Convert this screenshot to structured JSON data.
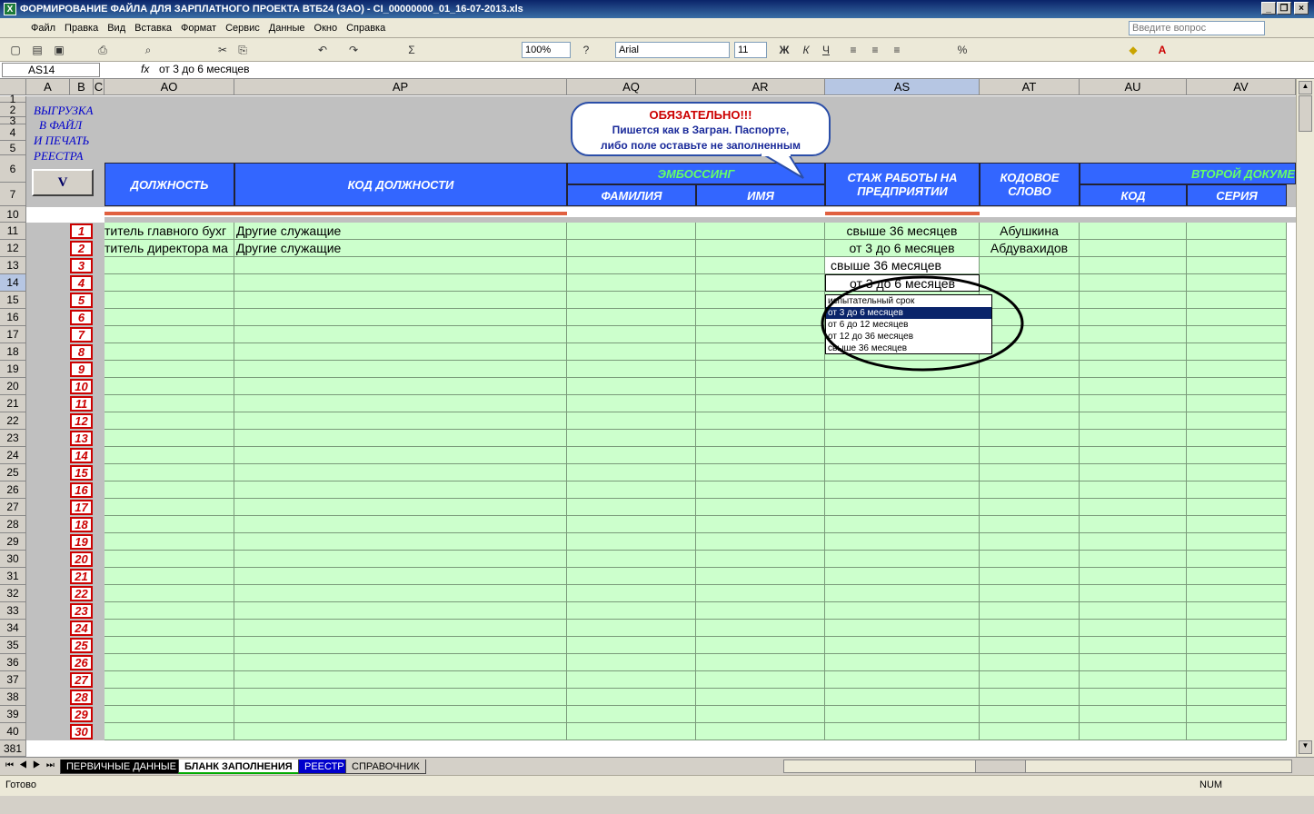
{
  "window": {
    "title": "ФОРМИРОВАНИЕ ФАЙЛА ДЛЯ ЗАРПЛАТНОГО ПРОЕКТА ВТБ24 (ЗАО) - CI_00000000_01_16-07-2013.xls"
  },
  "menu": {
    "items": [
      "Файл",
      "Правка",
      "Вид",
      "Вставка",
      "Формат",
      "Сервис",
      "Данные",
      "Окно",
      "Справка"
    ],
    "ask_placeholder": "Введите вопрос"
  },
  "toolbar": {
    "zoom": "100%",
    "font": "Arial",
    "size": "11"
  },
  "formula": {
    "cell_ref": "AS14",
    "fx": "fx",
    "value": "от 3 до 6 месяцев"
  },
  "columns": [
    "A",
    "B",
    "C",
    "AO",
    "AP",
    "AQ",
    "AR",
    "AS",
    "AT",
    "AU",
    "AV"
  ],
  "row_numbers": [
    "1",
    "2",
    "3",
    "4",
    "5",
    "6",
    "7",
    "10",
    "11",
    "12",
    "13",
    "14",
    "15",
    "16",
    "17",
    "18",
    "19",
    "20",
    "21",
    "22",
    "23",
    "24",
    "25",
    "26",
    "27",
    "28",
    "29",
    "30",
    "31",
    "32",
    "33",
    "34",
    "35",
    "36",
    "37",
    "38",
    "39",
    "40",
    "381"
  ],
  "left_panel": {
    "lines": [
      "ВЫГРУЗКА",
      "В ФАЙЛ",
      "И ПЕЧАТЬ",
      "РЕЕСТРА"
    ],
    "button": "V"
  },
  "callout": {
    "line1": "ОБЯЗАТЕЛЬНО!!!",
    "line2": "Пишется как в Загран. Паспорте,",
    "line3": "либо поле оставьте не заполненным"
  },
  "headers": {
    "position": "ДОЛЖНОСТЬ",
    "position_code": "КОД ДОЛЖНОСТИ",
    "embossing": "ЭМБОССИНГ",
    "surname": "ФАМИЛИЯ",
    "name": "ИМЯ",
    "tenure": "СТАЖ РАБОТЫ НА ПРЕДПРИЯТИИ",
    "codeword": "КОДОВОЕ СЛОВО",
    "second_doc": "ВТОРОЙ ДОКУМЕ",
    "code": "КОД",
    "series": "СЕРИЯ"
  },
  "rows": [
    {
      "n": "1",
      "position": "титель главного бухг",
      "code": "Другие служащие",
      "tenure": "свыше 36 месяцев",
      "codeword": "Абушкина"
    },
    {
      "n": "2",
      "position": "титель директора ма",
      "code": "Другие служащие",
      "tenure": "от 3 до 6 месяцев",
      "codeword": "Абдувахидов"
    },
    {
      "n": "3",
      "position": "",
      "code": "",
      "tenure": "свыше 36 месяцев",
      "codeword": ""
    },
    {
      "n": "4",
      "position": "",
      "code": "",
      "tenure": "от 3 до 6 месяцев",
      "codeword": ""
    }
  ],
  "row_indexes": [
    "5",
    "6",
    "7",
    "8",
    "9",
    "10",
    "11",
    "12",
    "13",
    "14",
    "15",
    "16",
    "17",
    "18",
    "19",
    "20",
    "21",
    "22",
    "23",
    "24",
    "25",
    "26",
    "27",
    "28",
    "29",
    "30"
  ],
  "dropdown": {
    "options": [
      "испытательный срок",
      "от 3 до 6 месяцев",
      "от 6 до 12 месяцев",
      "от 12 до 36 месяцев",
      "свыше 36 месяцев"
    ],
    "selected": 1
  },
  "sheets": [
    "ПЕРВИЧНЫЕ ДАННЫЕ",
    "БЛАНК ЗАПОЛНЕНИЯ",
    "РЕЕСТР",
    "СПРАВОЧНИК"
  ],
  "status": {
    "left": "Готово",
    "num": "NUM"
  }
}
